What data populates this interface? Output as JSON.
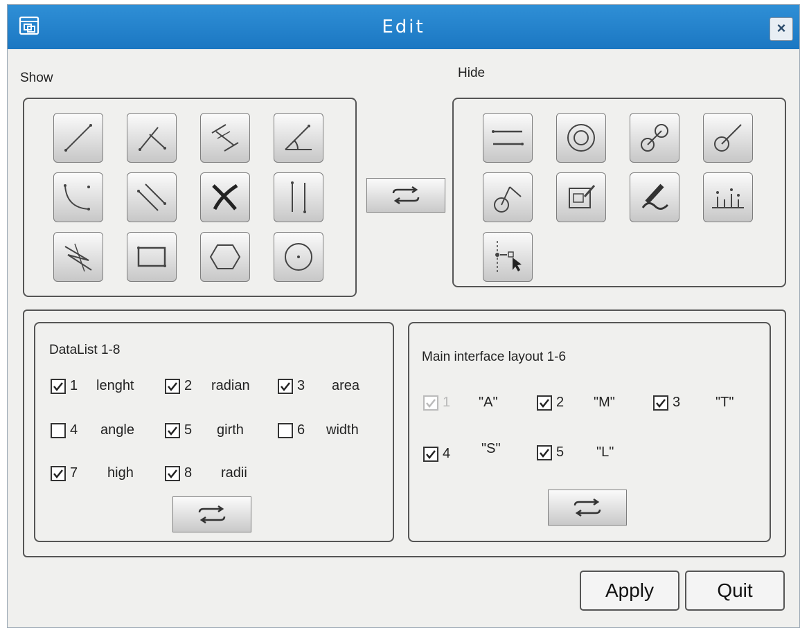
{
  "window": {
    "title": "Edit",
    "window_icon": "window-icon",
    "close_label": "×",
    "titlebar_color": "#2385cf"
  },
  "show_panel": {
    "label": "Show",
    "tools": [
      {
        "icon": "line-icon"
      },
      {
        "icon": "perpendicular-line-icon"
      },
      {
        "icon": "parallel-distance-icon"
      },
      {
        "icon": "angle-icon"
      },
      {
        "icon": "arc-icon"
      },
      {
        "icon": "parallel-lines-icon"
      },
      {
        "icon": "cross-curve-icon"
      },
      {
        "icon": "vertical-lines-icon"
      },
      {
        "icon": "zigzag-icon"
      },
      {
        "icon": "rectangle-icon"
      },
      {
        "icon": "hexagon-icon"
      },
      {
        "icon": "circle-center-icon"
      }
    ]
  },
  "hide_panel": {
    "label": "Hide",
    "tools": [
      {
        "icon": "horizontal-lines-icon"
      },
      {
        "icon": "concentric-circle-icon"
      },
      {
        "icon": "two-circles-icon"
      },
      {
        "icon": "circle-tangent-icon"
      },
      {
        "icon": "circle-line-icon"
      },
      {
        "icon": "edit-box-icon"
      },
      {
        "icon": "pen-curve-icon"
      },
      {
        "icon": "histogram-icon"
      },
      {
        "icon": "point-select-icon"
      }
    ]
  },
  "swap_icon": "swap-arrows-icon",
  "datalist": {
    "title": "DataList 1-8",
    "items": [
      {
        "num": "1",
        "label": "lenght",
        "checked": true
      },
      {
        "num": "2",
        "label": "radian",
        "checked": true
      },
      {
        "num": "3",
        "label": "area",
        "checked": true
      },
      {
        "num": "4",
        "label": "angle",
        "checked": false
      },
      {
        "num": "5",
        "label": "girth",
        "checked": true
      },
      {
        "num": "6",
        "label": "width",
        "checked": false
      },
      {
        "num": "7",
        "label": "high",
        "checked": true
      },
      {
        "num": "8",
        "label": "radii",
        "checked": true
      }
    ]
  },
  "layout": {
    "title": "Main interface layout 1-6",
    "items": [
      {
        "num": "1",
        "label": "\"A\"",
        "checked": true,
        "disabled": true
      },
      {
        "num": "2",
        "label": "\"M\"",
        "checked": true,
        "disabled": false
      },
      {
        "num": "3",
        "label": "\"T\"",
        "checked": true,
        "disabled": false
      },
      {
        "num": "4",
        "label": "\"S\"",
        "checked": true,
        "disabled": false
      },
      {
        "num": "5",
        "label": "\"L\"",
        "checked": true,
        "disabled": false
      }
    ]
  },
  "footer": {
    "apply_label": "Apply",
    "quit_label": "Quit"
  }
}
